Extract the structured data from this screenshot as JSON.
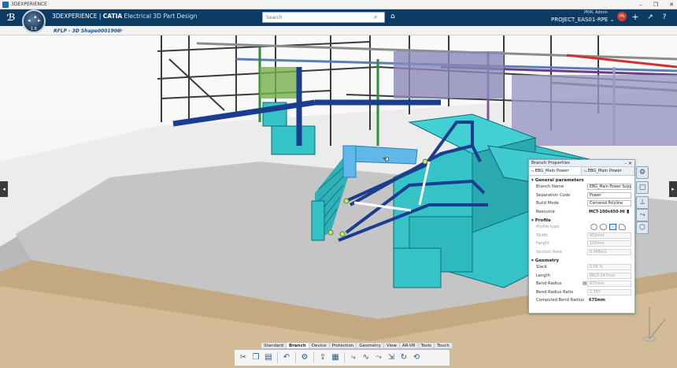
{
  "window": {
    "title": "3DEXPERIENCE",
    "controls": [
      "–",
      "❐",
      "✕"
    ]
  },
  "header": {
    "brand_prefix": "3DEXPERIENCE",
    "brand_sep": " | ",
    "brand_product": "CATIA",
    "brand_app": " Electrical 3D Part Design",
    "search_placeholder": "Search",
    "user_role": "PRM, Admin",
    "project": "PROJECT_EAS01-RPE ⌄",
    "avatar_text": "PA",
    "compass_version": "1.6"
  },
  "tabbar": {
    "active_tab": "RFLP - 3D Shape0001906",
    "add": "+"
  },
  "panel": {
    "title": "Branch Properties",
    "title_controls": "– ✕",
    "tabs": [
      "EBG_Main Power",
      "EBG_Main Power"
    ],
    "general": {
      "header": "General parameters",
      "rows": [
        {
          "label": "Branch Name",
          "value": "EBG_Main Power Supply"
        },
        {
          "label": "Separation Code",
          "value": "Power"
        },
        {
          "label": "Build Mode",
          "value": "Cornered Polyline"
        },
        {
          "label": "Resource",
          "value": "MCT-100x450-HI"
        }
      ]
    },
    "profile": {
      "header": "Profile",
      "rows": [
        {
          "label": "Profile type",
          "value": ""
        },
        {
          "label": "Width",
          "value": "450mm"
        },
        {
          "label": "Height",
          "value": "105mm"
        },
        {
          "label": "Section Area",
          "value": "0.048m2"
        }
      ]
    },
    "geometry": {
      "header": "Geometry",
      "rows": [
        {
          "label": "Slack",
          "value": "0.00 %"
        },
        {
          "label": "Length",
          "value": "6823.547mm"
        },
        {
          "label": "Bend Radius",
          "value": "675mm"
        },
        {
          "label": "Bend Radius Ratio",
          "value": "2.737"
        },
        {
          "label": "Computed Bend Radius",
          "value": "675mm"
        }
      ]
    }
  },
  "section_tabs": [
    "Standard",
    "Branch",
    "Device",
    "Protection",
    "Geometry",
    "View",
    "AR-VR",
    "Tools",
    "Touch"
  ],
  "active_section": "Branch",
  "colors": {
    "header_bg": "#0b3a62",
    "equipment": "#35c3c8",
    "conduit": "#1a3d8f",
    "steel": "#3b3b3b"
  }
}
